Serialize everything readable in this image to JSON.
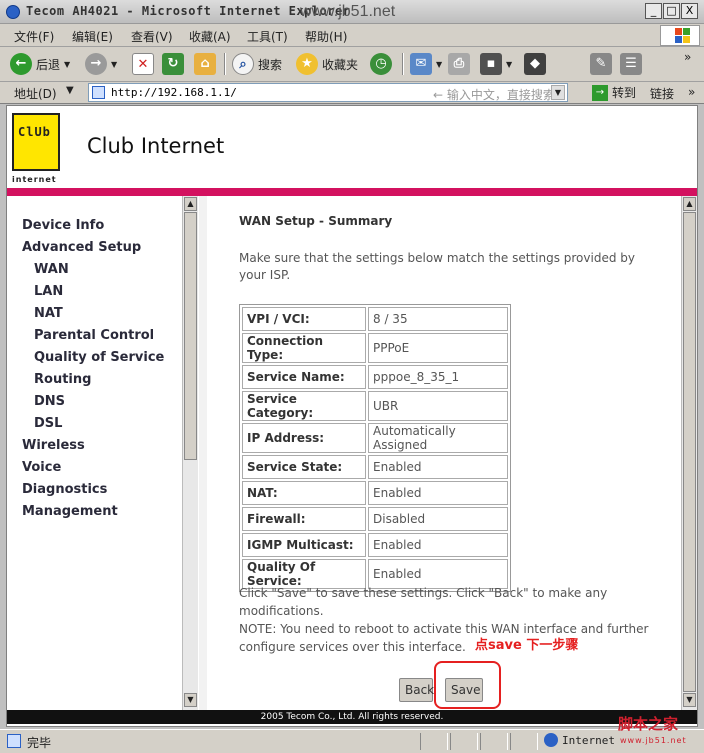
{
  "window": {
    "title": "Tecom AH4021 - Microsoft Internet Explorer",
    "watermark": "www.jb51.net",
    "min": "_",
    "max": "□",
    "close": "X"
  },
  "menubar": {
    "items": [
      "文件(F)",
      "编辑(E)",
      "查看(V)",
      "收藏(A)",
      "工具(T)",
      "帮助(H)"
    ]
  },
  "toolbar": {
    "back": "后退",
    "search": "搜索",
    "favorites": "收藏夹",
    "more": "»"
  },
  "addressbar": {
    "label": "地址(D)",
    "url": "http://192.168.1.1/",
    "search_hint": "输入中文，直接搜索",
    "go": "转到",
    "links": "链接",
    "more": "»"
  },
  "header": {
    "logo_text": "ClUb",
    "logo_sub": "internet",
    "brand": "Club Internet",
    "brand_color": "#d3115f"
  },
  "sidebar": {
    "items": [
      {
        "label": "Device Info",
        "level": 1
      },
      {
        "label": "Advanced Setup",
        "level": 1
      },
      {
        "label": "WAN",
        "level": 2
      },
      {
        "label": "LAN",
        "level": 2
      },
      {
        "label": "NAT",
        "level": 2
      },
      {
        "label": "Parental Control",
        "level": 2
      },
      {
        "label": "Quality of Service",
        "level": 2
      },
      {
        "label": "Routing",
        "level": 2
      },
      {
        "label": "DNS",
        "level": 2
      },
      {
        "label": "DSL",
        "level": 2
      },
      {
        "label": "Wireless",
        "level": 1
      },
      {
        "label": "Voice",
        "level": 1
      },
      {
        "label": "Diagnostics",
        "level": 1
      },
      {
        "label": "Management",
        "level": 1
      }
    ]
  },
  "main": {
    "title": "WAN Setup - Summary",
    "intro": "Make sure that the settings below match the settings provided by your ISP.",
    "summary": [
      {
        "key": "VPI / VCI:",
        "value": "8 / 35"
      },
      {
        "key": "Connection Type:",
        "value": "PPPoE"
      },
      {
        "key": "Service Name:",
        "value": "pppoe_8_35_1"
      },
      {
        "key": "Service Category:",
        "value": "UBR"
      },
      {
        "key": "IP Address:",
        "value": "Automatically Assigned"
      },
      {
        "key": "Service State:",
        "value": "Enabled"
      },
      {
        "key": "NAT:",
        "value": "Enabled"
      },
      {
        "key": "Firewall:",
        "value": "Disabled"
      },
      {
        "key": "IGMP Multicast:",
        "value": "Enabled"
      },
      {
        "key": "Quality Of Service:",
        "value": "Enabled"
      }
    ],
    "note1": "Click \"Save\" to save these settings. Click \"Back\" to make any modifications.",
    "note2": "NOTE: You need to reboot to activate this WAN interface and further configure services over this interface.",
    "annotation": "点save  下一步骤",
    "annotation_color": "#e52020",
    "back_label": "Back",
    "save_label": "Save"
  },
  "footer": {
    "text": "2005 Tecom Co., Ltd. All rights reserved."
  },
  "statusbar": {
    "text": "完毕",
    "zone": "Internet",
    "site_mark": "脚本之家",
    "site_url": "www.jb51.net"
  }
}
